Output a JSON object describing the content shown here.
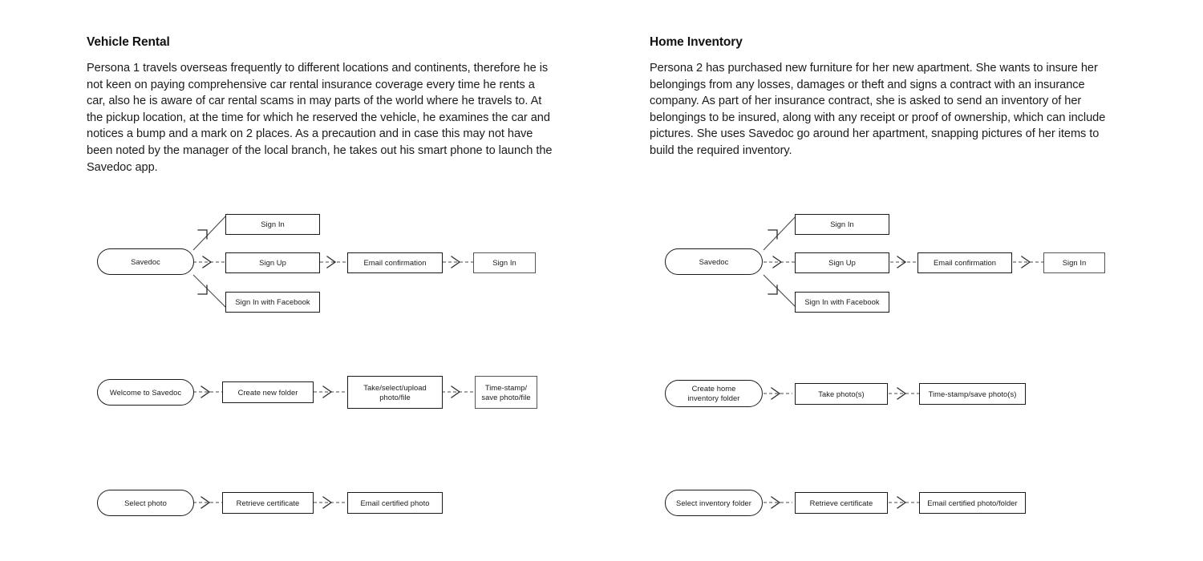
{
  "personas": [
    {
      "id": "vehicle-rental",
      "title": "Vehicle Rental",
      "body": "Persona 1 travels overseas frequently to different locations and continents, therefore he is not keen on paying comprehensive car rental insurance coverage every time he rents a car, also he is aware of car rental scams in may parts of the world where he travels to. At the pickup location, at the time for which he reserved the vehicle, he examines the car and notices a bump and a mark on 2 places. As a precaution and in case this may not have been noted by the manager of the local branch, he takes out his smart phone to launch the Savedoc app.",
      "flows": [
        {
          "id": "signup-flow",
          "start": "Savedoc",
          "branches": [
            "Sign In",
            "Sign Up",
            "Sign In with Facebook"
          ],
          "chain": [
            "Email confirmation",
            "Sign In"
          ]
        },
        {
          "id": "capture-flow",
          "steps": [
            "Welcome to Savedoc",
            "Create new folder",
            "Take/select/upload\nphoto/file",
            "Time-stamp/\nsave photo/file"
          ]
        },
        {
          "id": "certify-flow",
          "steps": [
            "Select photo",
            "Retrieve certificate",
            "Email certified photo"
          ]
        }
      ]
    },
    {
      "id": "home-inventory",
      "title": "Home Inventory",
      "body": "Persona 2 has purchased new furniture for her new apartment. She wants to insure her belongings from any losses, damages or theft and signs a contract with an insurance company. As part of her insurance contract, she is asked to send an inventory of her belongings to be insured, along with any receipt or proof of ownership, which can include pictures. She uses Savedoc go around her apartment, snapping pictures of her items to build the required inventory.",
      "flows": [
        {
          "id": "signup-flow",
          "start": "Savedoc",
          "branches": [
            "Sign In",
            "Sign Up",
            "Sign In with Facebook"
          ],
          "chain": [
            "Email confirmation",
            "Sign In"
          ]
        },
        {
          "id": "capture-flow",
          "steps": [
            "Create home\ninventory folder",
            "Take photo(s)",
            "Time-stamp/save photo(s)"
          ]
        },
        {
          "id": "certify-flow",
          "steps": [
            "Select inventory folder",
            "Retrieve certificate",
            "Email certified photo/folder"
          ]
        }
      ]
    }
  ],
  "colors": {
    "text": "#1a1a1a",
    "node_border": "#1a1a1a",
    "soft_border": "#555555",
    "connector": "#4a4a4a",
    "background": "#ffffff"
  }
}
